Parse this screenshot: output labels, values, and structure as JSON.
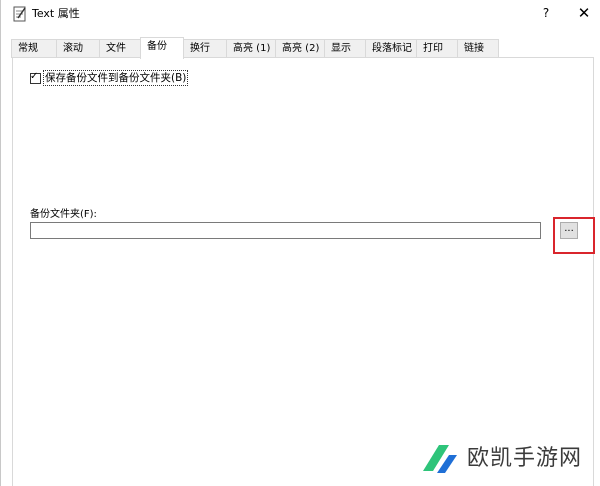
{
  "window": {
    "title": "Text 属性",
    "help_label": "?",
    "close_label": "✕"
  },
  "tabs": [
    {
      "label": "常规"
    },
    {
      "label": "滚动"
    },
    {
      "label": "文件"
    },
    {
      "label": "备份",
      "active": true
    },
    {
      "label": "换行"
    },
    {
      "label": "高亮 (1)"
    },
    {
      "label": "高亮 (2)"
    },
    {
      "label": "显示"
    },
    {
      "label": "段落标记"
    },
    {
      "label": "打印"
    },
    {
      "label": "链接"
    }
  ],
  "backup": {
    "save_checkbox_label": "保存备份文件到备份文件夹(B)",
    "save_checkbox_checked": true,
    "folder_label": "备份文件夹(F):",
    "folder_value": "",
    "browse_label": "..."
  },
  "colors": {
    "highlight": "#d9252c",
    "watermark_green": "#2ec47a",
    "watermark_blue": "#1f6fd6"
  },
  "watermark": {
    "text": "欧凯手游网"
  }
}
